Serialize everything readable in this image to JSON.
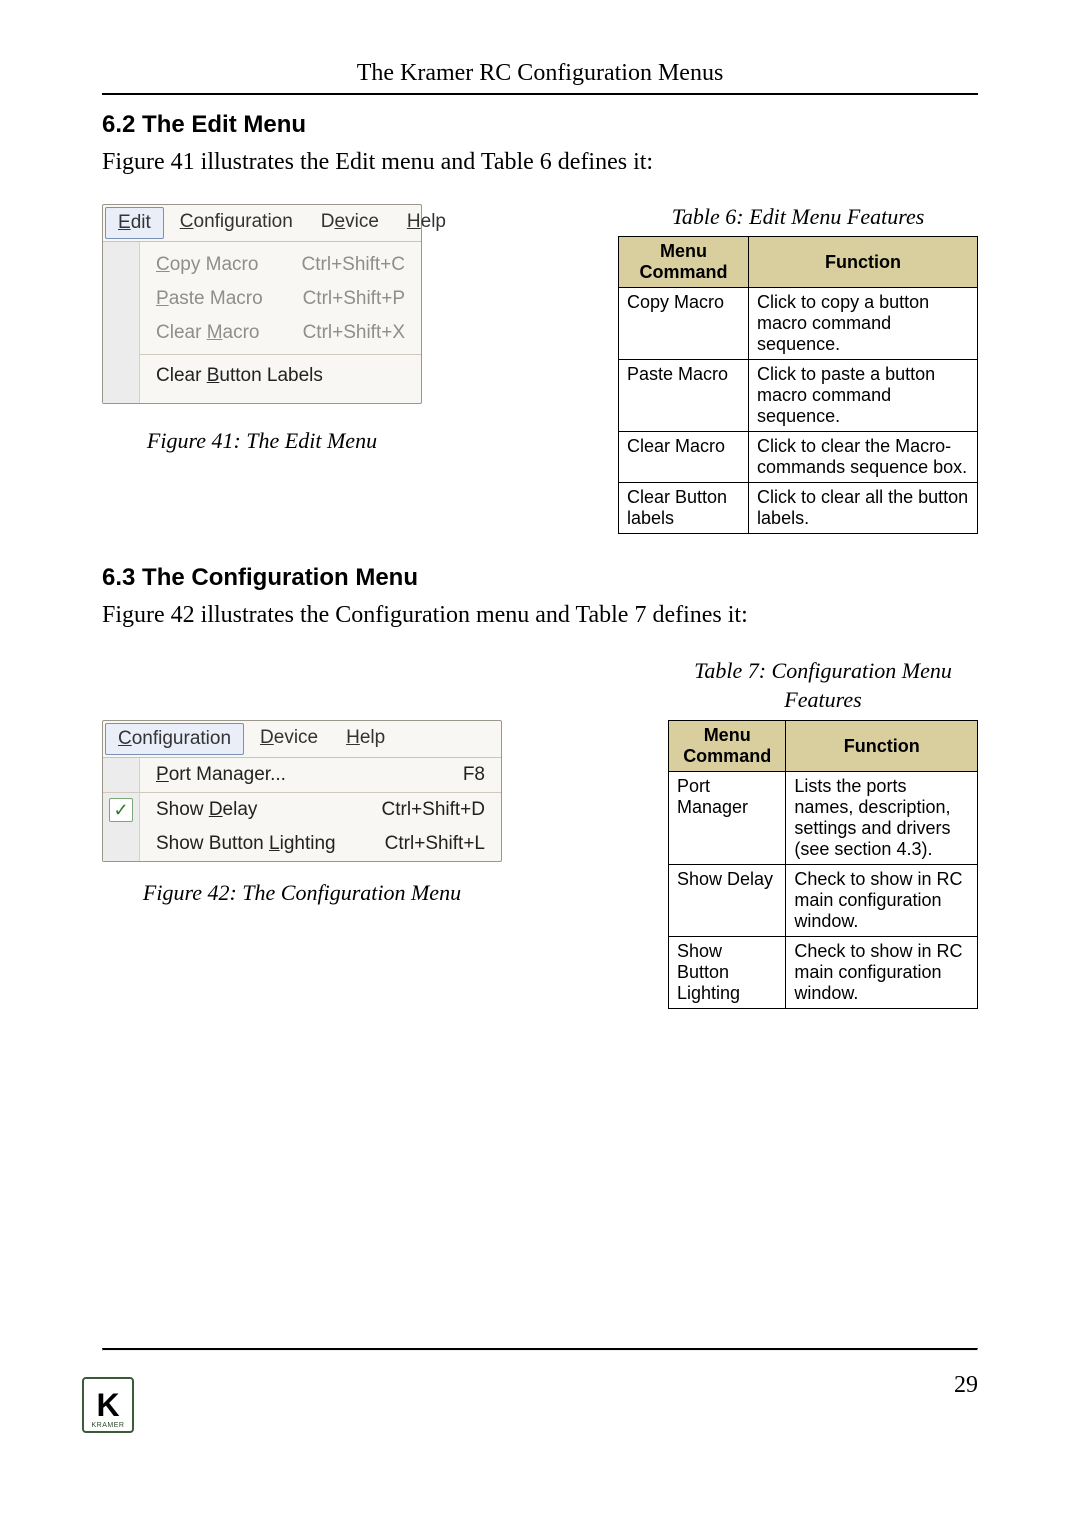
{
  "header": {
    "running_head": "The Kramer RC Configuration Menus"
  },
  "footer": {
    "page_number": "29",
    "logo_text": "K",
    "logo_sub": "KRAMER"
  },
  "s62": {
    "heading": "6.2  The Edit Menu",
    "intro": "Figure 41 illustrates the Edit menu and Table 6 defines it:",
    "table_caption": "Table 6: Edit Menu Features",
    "figure_caption": "Figure 41: The Edit Menu",
    "menu": {
      "bar": [
        "Edit",
        "Configuration",
        "Device",
        "Help"
      ],
      "active_index": 0,
      "items": [
        {
          "label": "Copy Macro",
          "accel_key": "C",
          "shortcut": "Ctrl+Shift+C",
          "enabled": false
        },
        {
          "label": "Paste Macro",
          "accel_key": "P",
          "shortcut": "Ctrl+Shift+P",
          "enabled": false
        },
        {
          "label": "Clear Macro",
          "accel_key": "M",
          "shortcut": "Ctrl+Shift+X",
          "enabled": false
        }
      ],
      "after_sep_item": {
        "label": "Clear Button Labels",
        "accel_key": "B",
        "enabled": true
      }
    },
    "table": {
      "headers": [
        "Menu Command",
        "Function"
      ],
      "rows": [
        [
          "Copy Macro",
          "Click to copy a button macro command sequence."
        ],
        [
          "Paste Macro",
          "Click to paste a button macro command sequence."
        ],
        [
          "Clear Macro",
          "Click to clear the Macro-commands sequence box."
        ],
        [
          "Clear Button labels",
          "Click to clear all the button labels."
        ]
      ]
    }
  },
  "s63": {
    "heading": "6.3  The Configuration Menu",
    "intro": "Figure 42 illustrates the Configuration menu and Table 7 defines it:",
    "table_caption": "Table 7: Configuration Menu Features",
    "figure_caption": "Figure 42: The Configuration Menu",
    "menu": {
      "bar": [
        "Configuration",
        "Device",
        "Help"
      ],
      "active_index": 0,
      "items": [
        {
          "label": "Port Manager...",
          "accel_key": "P",
          "shortcut": "F8",
          "enabled": true,
          "checked": false
        },
        {
          "sep": true
        },
        {
          "label": "Show Delay",
          "accel_key": "D",
          "shortcut": "Ctrl+Shift+D",
          "enabled": true,
          "checked": true
        },
        {
          "label": "Show Button Lighting",
          "accel_key": "L",
          "shortcut": "Ctrl+Shift+L",
          "enabled": true,
          "checked": false
        }
      ]
    },
    "table": {
      "headers": [
        "Menu Command",
        "Function"
      ],
      "rows": [
        [
          "Port Manager",
          "Lists the ports names, description, settings and drivers (see section 4.3)."
        ],
        [
          "Show Delay",
          "Check to show in RC main configuration window."
        ],
        [
          "Show Button Lighting",
          "Check to show in RC main configuration window."
        ]
      ]
    }
  }
}
